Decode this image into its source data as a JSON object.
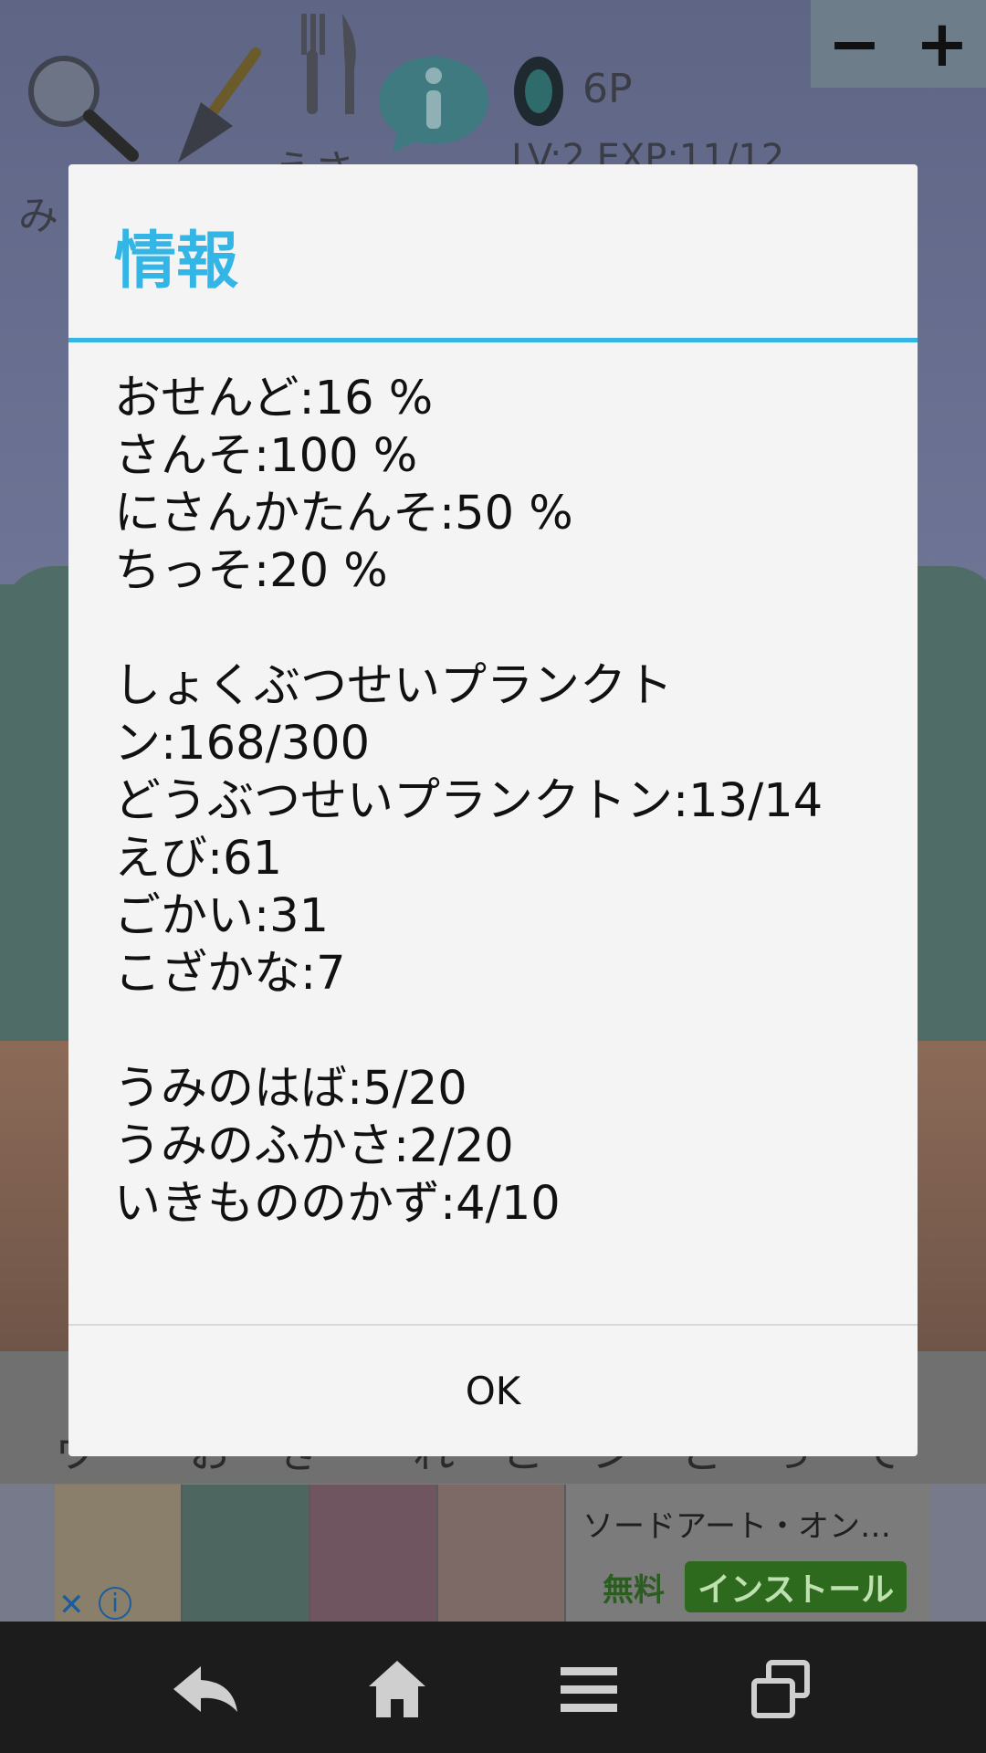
{
  "background": {
    "zoom_out": "−",
    "zoom_in": "+",
    "points": "6P",
    "level": "LV:2 EXP:11/12",
    "label_left": "み",
    "label_food": "えさ",
    "bottom_text": "ウ　　お　き　　れ　こ　ン　ど　っ　て　い　　ルプ"
  },
  "dialog": {
    "title": "情報",
    "stats_water": [
      "おせんど:16 %",
      "さんそ:100 %",
      "にさんかたんそ:50 %",
      "ちっそ:20 %"
    ],
    "stats_life": [
      "しょくぶつせいプランクト",
      "ン:168/300",
      "どうぶつせいプランクトン:13/14",
      "えび:61",
      "ごかい:31",
      "こざかな:7"
    ],
    "stats_sea": [
      "うみのはば:5/20",
      "うみのふかさ:2/20",
      "いきもののかず:4/10"
    ],
    "ok_label": "OK"
  },
  "ad": {
    "title": "ソードアート・オン…",
    "free_label": "無料",
    "install_label": "インストール",
    "close_glyph": "✕",
    "info_glyph": "i"
  },
  "colors": {
    "accent": "#33b5e5",
    "dialog_bg": "#f4f4f4",
    "navbar_bg": "#1c1c1c"
  },
  "icons": [
    "magnifier-icon",
    "trowel-icon",
    "fork-knife-icon",
    "info-bubble-icon",
    "gem-icon",
    "back-icon",
    "home-icon",
    "menu-icon",
    "recent-apps-icon"
  ]
}
